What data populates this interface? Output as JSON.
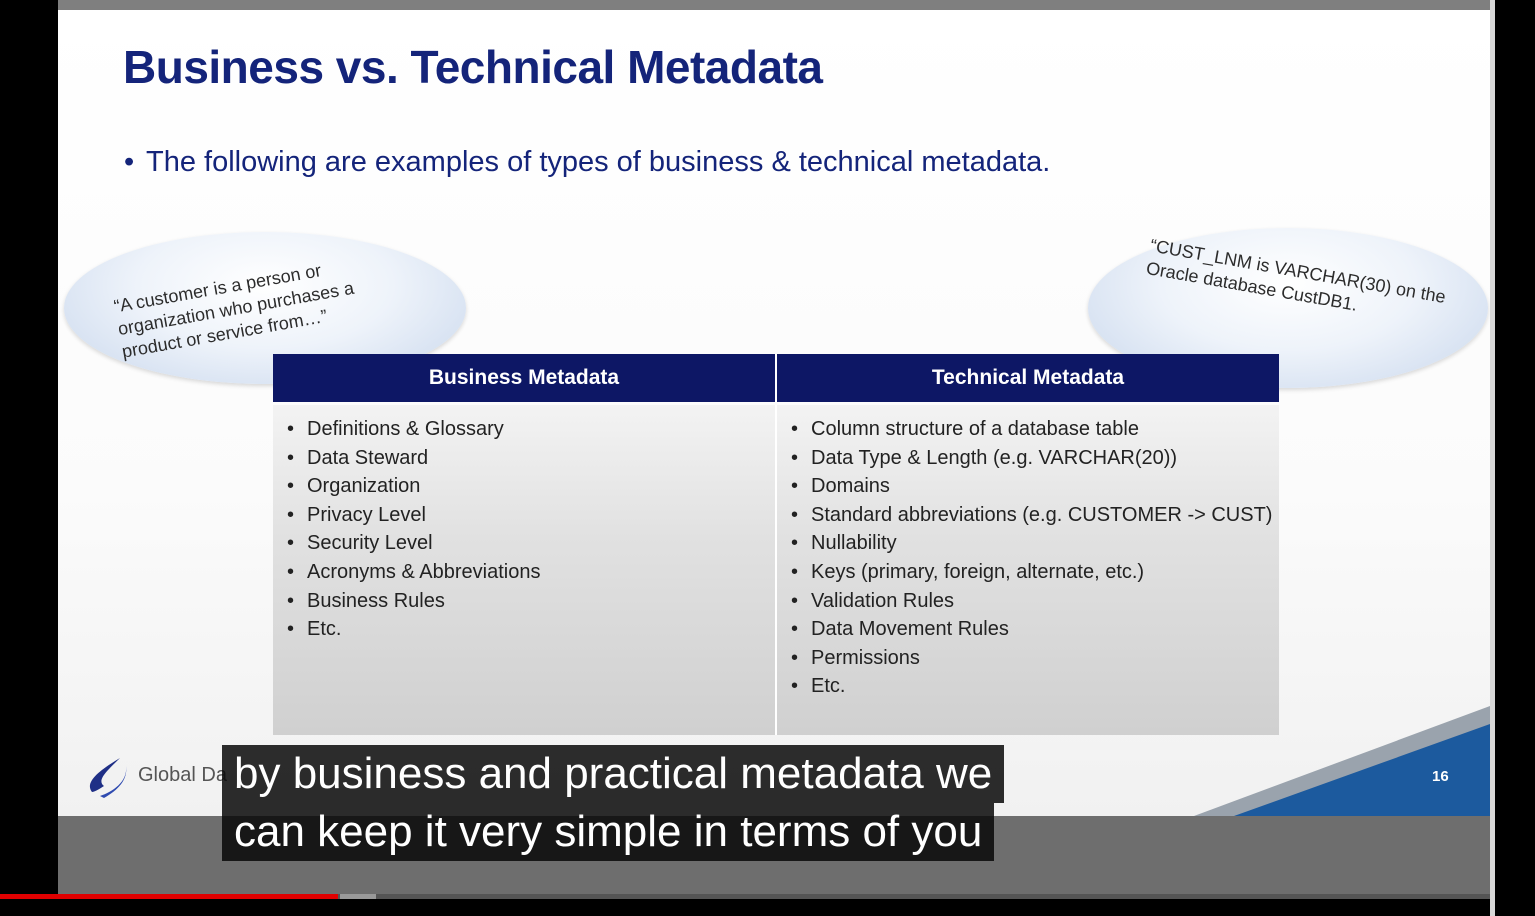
{
  "slide": {
    "title": "Business vs. Technical Metadata",
    "bullet": "The following are examples of types of business & technical metadata.",
    "bubble_left": "“A customer is a person or organization who purchases a product or service from…”",
    "bubble_right": "“CUST_LNM is VARCHAR(30) on the Oracle database CustDB1.",
    "table": {
      "headers": [
        "Business Metadata",
        "Technical Metadata"
      ],
      "business_items": [
        "Definitions & Glossary",
        "Data Steward",
        "Organization",
        "Privacy Level",
        "Security Level",
        "Acronyms & Abbreviations",
        "Business Rules",
        "Etc."
      ],
      "technical_items": [
        "Column structure of a database table",
        "Data Type & Length (e.g. VARCHAR(20))",
        "Domains",
        "Standard abbreviations (e.g. CUSTOMER -> CUST)",
        "Nullability",
        "Keys (primary, foreign, alternate, etc.)",
        "Validation Rules",
        "Data Movement Rules",
        "Permissions",
        "Etc."
      ]
    },
    "footer_logo_text": "Global Da",
    "page_number": "16"
  },
  "captions": {
    "line1": "by business and practical metadata we",
    "line2": "can keep it very simple in terms of you"
  },
  "player": {
    "progress_fraction": 0.22
  },
  "colors": {
    "title": "#14247a",
    "table_header": "#0d1765",
    "progress_played": "#e00000"
  }
}
